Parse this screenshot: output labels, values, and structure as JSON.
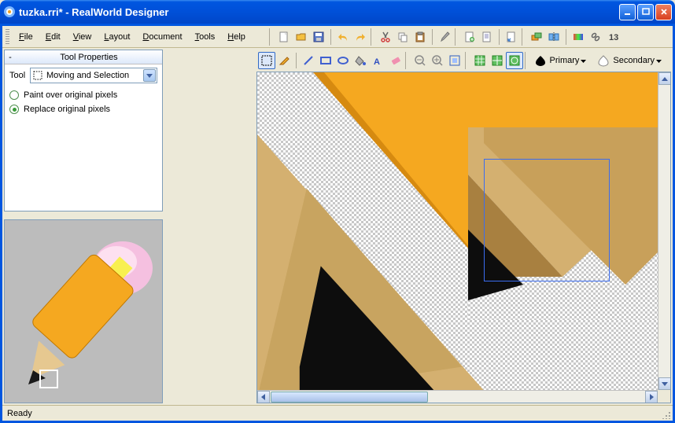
{
  "window": {
    "title": "tuzka.rri* - RealWorld Designer"
  },
  "menu": {
    "file": "File",
    "edit": "Edit",
    "view": "View",
    "layout": "Layout",
    "document": "Document",
    "tools": "Tools",
    "help": "Help"
  },
  "panel": {
    "title": "Tool Properties",
    "tool_label": "Tool",
    "tool_value": "Moving and Selection",
    "option1": "Paint over original pixels",
    "option2": "Replace original pixels"
  },
  "toolbar": {
    "primary": "Primary",
    "secondary": "Secondary",
    "primary_color": "#000000",
    "secondary_color": "#ffffff"
  },
  "status": {
    "text": "Ready"
  }
}
